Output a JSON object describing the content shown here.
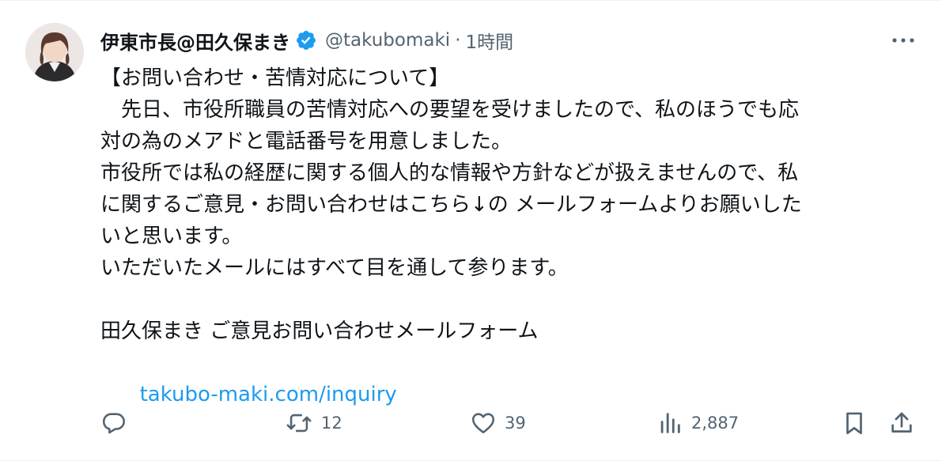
{
  "author": {
    "name": "伊東市長@田久保まき",
    "handle": "@takubomaki",
    "separator": "·",
    "time": "1時間",
    "verified_color": "#1d9bf0"
  },
  "tweet": {
    "lines": [
      "【お問い合わせ・苦情対応について】",
      "　先日、市役所職員の苦情対応への要望を受けましたので、私のほうでも応",
      "対の為のメアドと電話番号を用意しました。",
      "市役所では私の経歴に関する個人的な情報や方針などが扱えませんので、私",
      "に関するご意見・お問い合わせはこちら↓の メールフォームよりお願いした",
      "いと思います。",
      "いただいたメールにはすべて目を通して参ります。",
      "",
      "田久保まき ご意見お問い合わせメールフォーム"
    ],
    "link_text": "takubo-maki.com/inquiry",
    "link_color": "#1d9bf0"
  },
  "actions": {
    "reply_icon": "reply-icon",
    "retweet_icon": "retweet-icon",
    "retweet_count": "12",
    "like_icon": "heart-icon",
    "like_count": "39",
    "views_icon": "views-icon",
    "views_count": "2,887",
    "bookmark_icon": "bookmark-icon",
    "share_icon": "share-icon"
  }
}
